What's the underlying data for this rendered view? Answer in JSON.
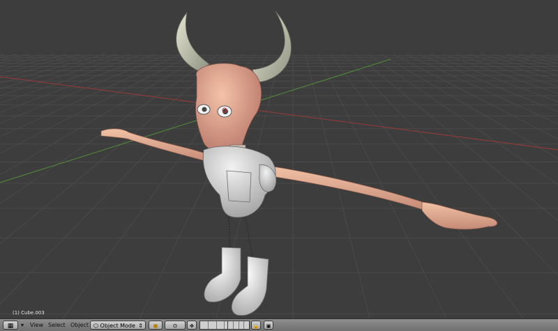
{
  "viewport": {
    "object_label": "(1) Cube.003"
  },
  "header": {
    "menus": {
      "view": "View",
      "select": "Select",
      "object": "Object"
    },
    "mode_select": {
      "label": "Object Mode",
      "arrows": "⇕"
    },
    "editor_type_icon": "grid-icon",
    "collapse_arrow": "▾"
  },
  "colors": {
    "viewport_bg": "#3c3c3c",
    "grid_line": "#4a4a4a",
    "x_axis": "#8e3a3a",
    "y_axis": "#5a8a3a",
    "skin": "#e8a58a",
    "armor": "#d8d8d8",
    "horn": "#d8d8c0",
    "header_bg": "#7a7a7a"
  }
}
